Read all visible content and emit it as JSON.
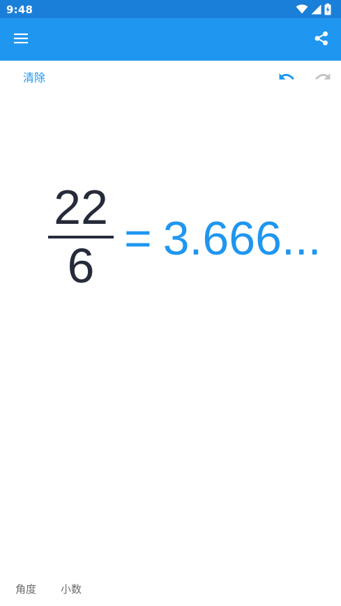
{
  "status_bar": {
    "time": "9:48",
    "icons": [
      "wifi-icon",
      "cell-signal-icon",
      "battery-charging-icon"
    ]
  },
  "app_bar": {
    "menu_icon": "menu-icon",
    "share_icon": "share-icon",
    "background_color": "#1f96f0"
  },
  "toolbar": {
    "clear_label": "清除",
    "undo_icon": "undo-icon",
    "redo_icon": "redo-icon"
  },
  "expression": {
    "numerator": "22",
    "denominator": "6",
    "equals": "=",
    "result": "3.666..."
  },
  "modes": {
    "angle_label": "角度",
    "decimal_label": "小数"
  },
  "colors": {
    "accent": "#1f96f0",
    "status_bar": "#1a7fd9",
    "expression_text": "#262b3a",
    "disabled_icon": "#c4c4c4",
    "mode_text": "#6b6b6b"
  }
}
